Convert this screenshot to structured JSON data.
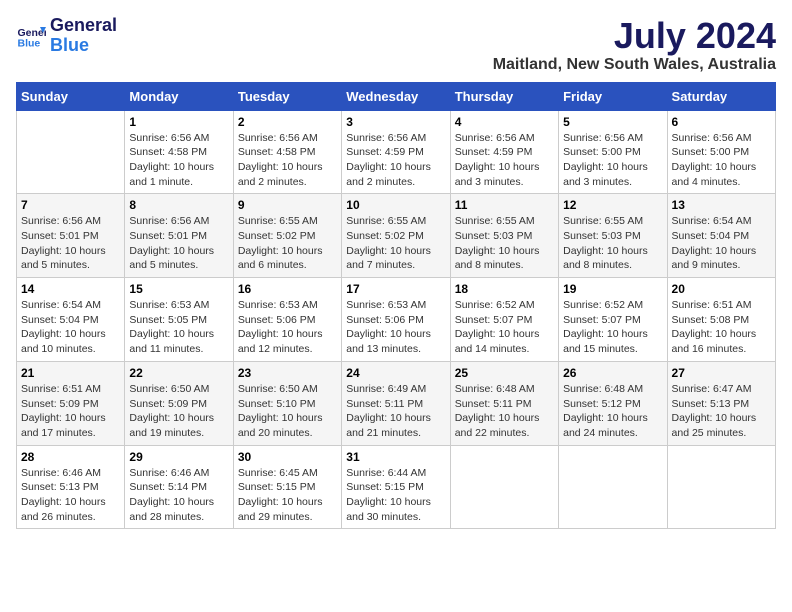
{
  "header": {
    "logo_line1": "General",
    "logo_line2": "Blue",
    "month_year": "July 2024",
    "location": "Maitland, New South Wales, Australia"
  },
  "days_of_week": [
    "Sunday",
    "Monday",
    "Tuesday",
    "Wednesday",
    "Thursday",
    "Friday",
    "Saturday"
  ],
  "weeks": [
    [
      {
        "num": "",
        "info": ""
      },
      {
        "num": "1",
        "info": "Sunrise: 6:56 AM\nSunset: 4:58 PM\nDaylight: 10 hours\nand 1 minute."
      },
      {
        "num": "2",
        "info": "Sunrise: 6:56 AM\nSunset: 4:58 PM\nDaylight: 10 hours\nand 2 minutes."
      },
      {
        "num": "3",
        "info": "Sunrise: 6:56 AM\nSunset: 4:59 PM\nDaylight: 10 hours\nand 2 minutes."
      },
      {
        "num": "4",
        "info": "Sunrise: 6:56 AM\nSunset: 4:59 PM\nDaylight: 10 hours\nand 3 minutes."
      },
      {
        "num": "5",
        "info": "Sunrise: 6:56 AM\nSunset: 5:00 PM\nDaylight: 10 hours\nand 3 minutes."
      },
      {
        "num": "6",
        "info": "Sunrise: 6:56 AM\nSunset: 5:00 PM\nDaylight: 10 hours\nand 4 minutes."
      }
    ],
    [
      {
        "num": "7",
        "info": "Sunrise: 6:56 AM\nSunset: 5:01 PM\nDaylight: 10 hours\nand 5 minutes."
      },
      {
        "num": "8",
        "info": "Sunrise: 6:56 AM\nSunset: 5:01 PM\nDaylight: 10 hours\nand 5 minutes."
      },
      {
        "num": "9",
        "info": "Sunrise: 6:55 AM\nSunset: 5:02 PM\nDaylight: 10 hours\nand 6 minutes."
      },
      {
        "num": "10",
        "info": "Sunrise: 6:55 AM\nSunset: 5:02 PM\nDaylight: 10 hours\nand 7 minutes."
      },
      {
        "num": "11",
        "info": "Sunrise: 6:55 AM\nSunset: 5:03 PM\nDaylight: 10 hours\nand 8 minutes."
      },
      {
        "num": "12",
        "info": "Sunrise: 6:55 AM\nSunset: 5:03 PM\nDaylight: 10 hours\nand 8 minutes."
      },
      {
        "num": "13",
        "info": "Sunrise: 6:54 AM\nSunset: 5:04 PM\nDaylight: 10 hours\nand 9 minutes."
      }
    ],
    [
      {
        "num": "14",
        "info": "Sunrise: 6:54 AM\nSunset: 5:04 PM\nDaylight: 10 hours\nand 10 minutes."
      },
      {
        "num": "15",
        "info": "Sunrise: 6:53 AM\nSunset: 5:05 PM\nDaylight: 10 hours\nand 11 minutes."
      },
      {
        "num": "16",
        "info": "Sunrise: 6:53 AM\nSunset: 5:06 PM\nDaylight: 10 hours\nand 12 minutes."
      },
      {
        "num": "17",
        "info": "Sunrise: 6:53 AM\nSunset: 5:06 PM\nDaylight: 10 hours\nand 13 minutes."
      },
      {
        "num": "18",
        "info": "Sunrise: 6:52 AM\nSunset: 5:07 PM\nDaylight: 10 hours\nand 14 minutes."
      },
      {
        "num": "19",
        "info": "Sunrise: 6:52 AM\nSunset: 5:07 PM\nDaylight: 10 hours\nand 15 minutes."
      },
      {
        "num": "20",
        "info": "Sunrise: 6:51 AM\nSunset: 5:08 PM\nDaylight: 10 hours\nand 16 minutes."
      }
    ],
    [
      {
        "num": "21",
        "info": "Sunrise: 6:51 AM\nSunset: 5:09 PM\nDaylight: 10 hours\nand 17 minutes."
      },
      {
        "num": "22",
        "info": "Sunrise: 6:50 AM\nSunset: 5:09 PM\nDaylight: 10 hours\nand 19 minutes."
      },
      {
        "num": "23",
        "info": "Sunrise: 6:50 AM\nSunset: 5:10 PM\nDaylight: 10 hours\nand 20 minutes."
      },
      {
        "num": "24",
        "info": "Sunrise: 6:49 AM\nSunset: 5:11 PM\nDaylight: 10 hours\nand 21 minutes."
      },
      {
        "num": "25",
        "info": "Sunrise: 6:48 AM\nSunset: 5:11 PM\nDaylight: 10 hours\nand 22 minutes."
      },
      {
        "num": "26",
        "info": "Sunrise: 6:48 AM\nSunset: 5:12 PM\nDaylight: 10 hours\nand 24 minutes."
      },
      {
        "num": "27",
        "info": "Sunrise: 6:47 AM\nSunset: 5:13 PM\nDaylight: 10 hours\nand 25 minutes."
      }
    ],
    [
      {
        "num": "28",
        "info": "Sunrise: 6:46 AM\nSunset: 5:13 PM\nDaylight: 10 hours\nand 26 minutes."
      },
      {
        "num": "29",
        "info": "Sunrise: 6:46 AM\nSunset: 5:14 PM\nDaylight: 10 hours\nand 28 minutes."
      },
      {
        "num": "30",
        "info": "Sunrise: 6:45 AM\nSunset: 5:15 PM\nDaylight: 10 hours\nand 29 minutes."
      },
      {
        "num": "31",
        "info": "Sunrise: 6:44 AM\nSunset: 5:15 PM\nDaylight: 10 hours\nand 30 minutes."
      },
      {
        "num": "",
        "info": ""
      },
      {
        "num": "",
        "info": ""
      },
      {
        "num": "",
        "info": ""
      }
    ]
  ]
}
